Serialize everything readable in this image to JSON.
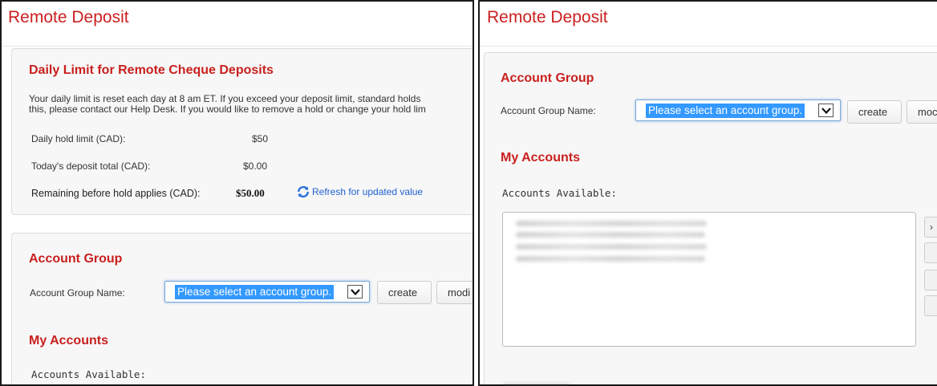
{
  "page": {
    "title": "Remote Deposit"
  },
  "daily_limit": {
    "heading": "Daily Limit for Remote Cheque Deposits",
    "description_line1": "Your daily limit is reset each day at 8 am ET. If you exceed your deposit limit, standard holds",
    "description_line2": "this, please contact our Help Desk. If you would like to remove a hold or change your hold lim",
    "rows": [
      {
        "label": "Daily hold limit (CAD):",
        "value": "$50"
      },
      {
        "label": "Today's deposit total (CAD):",
        "value": "$0.00"
      },
      {
        "label": "Remaining before hold applies (CAD):",
        "value": "$50.00"
      }
    ],
    "refresh_label": "Refresh for updated value"
  },
  "account_group": {
    "heading": "Account Group",
    "name_label": "Account Group Name:",
    "select_value": "Please select an account group.",
    "create_label": "create",
    "modify_label_left": "modi",
    "modify_label_right": "moc"
  },
  "my_accounts": {
    "heading": "My Accounts",
    "available_label": "Accounts Available:",
    "account_rows": 4
  },
  "colors": {
    "heading": "#c8201e",
    "title": "#cc1f1f",
    "link": "#1f5fd1",
    "selection": "#3399ff"
  },
  "icons": {
    "refresh": "refresh-icon",
    "dropdown": "chevron-down-icon"
  }
}
